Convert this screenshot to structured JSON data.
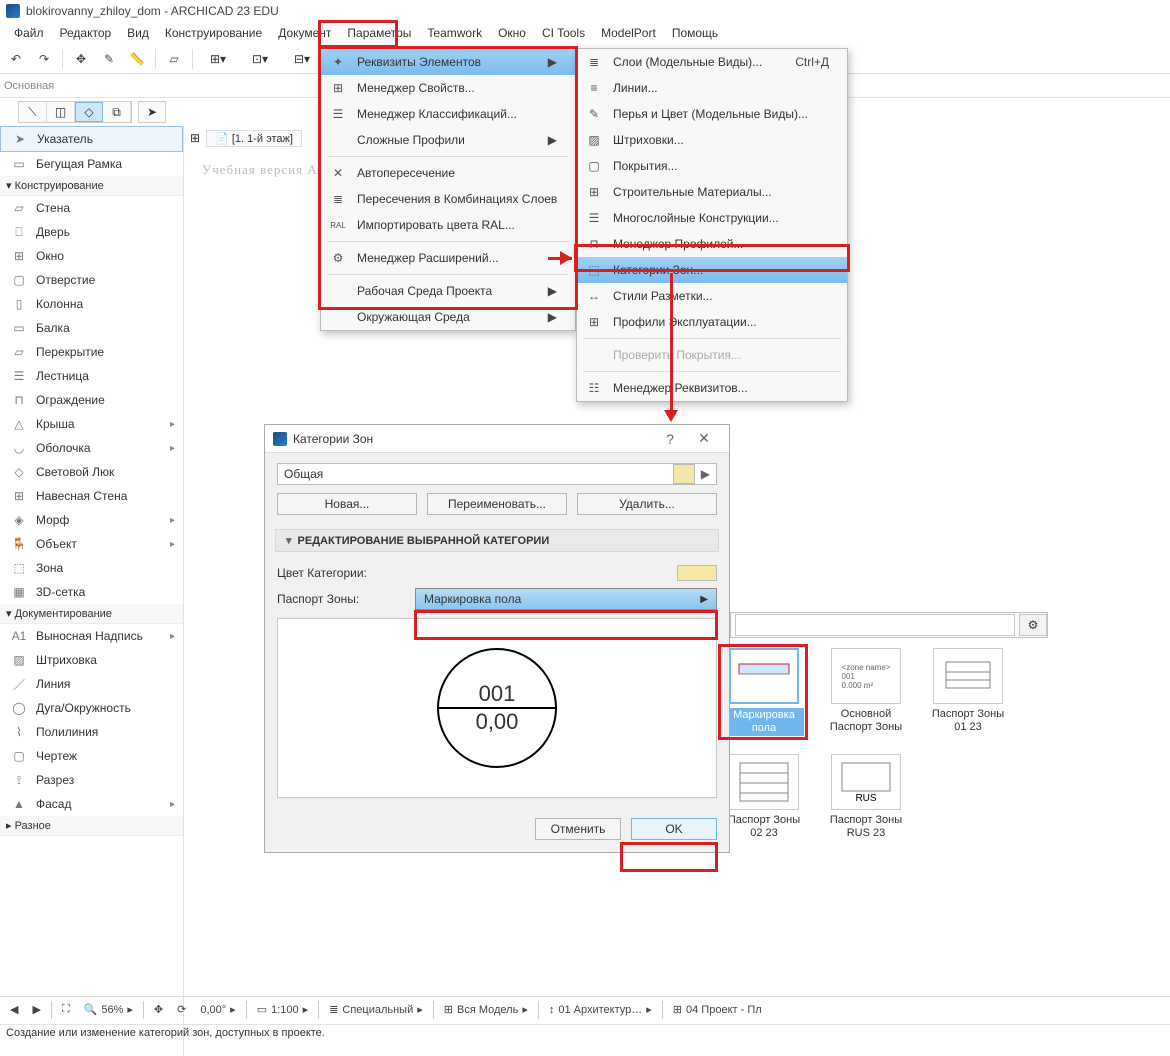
{
  "window": {
    "title": "blokirovanny_zhiloy_dom - ARCHICAD 23 EDU"
  },
  "menubar": [
    "Файл",
    "Редактор",
    "Вид",
    "Конструирование",
    "Документ",
    "Параметры",
    "Teamwork",
    "Окно",
    "CI Tools",
    "ModelPort",
    "Помощь"
  ],
  "sub_toolbar_label": "Основная",
  "menu_params": {
    "items": [
      {
        "label": "Реквизиты Элементов",
        "arrow": true,
        "hl": true
      },
      {
        "label": "Менеджер Свойств...",
        "icon": "grid"
      },
      {
        "label": "Менеджер Классификаций...",
        "icon": "stack"
      },
      {
        "label": "Сложные Профили",
        "arrow": true
      },
      {
        "label": "Автопересечение",
        "icon": "cross",
        "sep_before": true
      },
      {
        "label": "Пересечения в Комбинациях Слоев",
        "icon": "layers"
      },
      {
        "label": "Импортировать цвета RAL...",
        "icon": "RAL"
      },
      {
        "label": "Менеджер Расширений...",
        "icon": "plug",
        "sep_before": true
      },
      {
        "label": "Рабочая Среда Проекта",
        "arrow": true,
        "sep_before": true
      },
      {
        "label": "Окружающая Среда",
        "arrow": true
      }
    ]
  },
  "menu_rekv": {
    "items": [
      {
        "label": "Слои (Модельные Виды)...",
        "shortcut": "Ctrl+Д",
        "icon": "layers"
      },
      {
        "label": "Линии...",
        "icon": "lines"
      },
      {
        "label": "Перья и Цвет (Модельные Виды)...",
        "icon": "pen"
      },
      {
        "label": "Штриховки...",
        "icon": "hatch"
      },
      {
        "label": "Покрытия...",
        "icon": "surf"
      },
      {
        "label": "Строительные Материалы...",
        "icon": "mat"
      },
      {
        "label": "Многослойные Конструкции...",
        "icon": "multi"
      },
      {
        "label": "Менеджер Профилей...",
        "icon": "prof"
      },
      {
        "label": "Категории Зон...",
        "icon": "zone",
        "hl": true
      },
      {
        "label": "Стили Разметки...",
        "icon": "dim"
      },
      {
        "label": "Профили Эксплуатации...",
        "icon": "exp"
      },
      {
        "label": "Проверить Покрытия...",
        "disabled": true,
        "sep_before": true
      },
      {
        "label": "Менеджер Реквизитов...",
        "icon": "mgr",
        "sep_before": true
      }
    ]
  },
  "sidebar": {
    "sections": [
      {
        "title": "",
        "items": [
          {
            "label": "Указатель",
            "sel": true
          },
          {
            "label": "Бегущая Рамка"
          }
        ]
      },
      {
        "title": "Конструирование",
        "collapsible": true,
        "items": [
          {
            "label": "Стена"
          },
          {
            "label": "Дверь"
          },
          {
            "label": "Окно"
          },
          {
            "label": "Отверстие"
          },
          {
            "label": "Колонна"
          },
          {
            "label": "Балка"
          },
          {
            "label": "Перекрытие"
          },
          {
            "label": "Лестница"
          },
          {
            "label": "Ограждение"
          },
          {
            "label": "Крыша",
            "arrow": true
          },
          {
            "label": "Оболочка",
            "arrow": true
          },
          {
            "label": "Световой Люк"
          },
          {
            "label": "Навесная Стена"
          },
          {
            "label": "Морф",
            "arrow": true
          },
          {
            "label": "Объект",
            "arrow": true
          },
          {
            "label": "Зона"
          },
          {
            "label": "3D-сетка"
          }
        ]
      },
      {
        "title": "Документирование",
        "collapsible": true,
        "items": [
          {
            "label": "Выносная Надпись",
            "arrow": true,
            "prefix": "A1"
          },
          {
            "label": "Штриховка"
          },
          {
            "label": "Линия"
          },
          {
            "label": "Дуга/Окружность"
          },
          {
            "label": "Полилиния"
          },
          {
            "label": "Чертеж"
          },
          {
            "label": "Разрез"
          },
          {
            "label": "Фасад",
            "arrow": true
          }
        ]
      },
      {
        "title": "Разное",
        "collapsible": true,
        "items": []
      }
    ]
  },
  "tab": {
    "name": "[1. 1-й этаж]"
  },
  "watermark": "Учебная версия ARCHI",
  "dialog": {
    "title": "Категории Зон",
    "category_selected": "Общая",
    "btn_new": "Новая...",
    "btn_rename": "Переименовать...",
    "btn_delete": "Удалить...",
    "section": "РЕДАКТИРОВАНИЕ ВЫБРАННОЙ КАТЕГОРИИ",
    "lbl_color": "Цвет Категории:",
    "lbl_passport": "Паспорт Зоны:",
    "passport_value": "Маркировка пола",
    "preview_top": "001",
    "preview_bottom": "0,00",
    "btn_cancel": "Отменить",
    "btn_ok": "OK"
  },
  "gallery": {
    "items": [
      {
        "label": "Маркировка пола",
        "sel": true
      },
      {
        "label": "Основной Паспорт Зоны"
      },
      {
        "label": "Паспорт Зоны 01 23"
      },
      {
        "label": "Паспорт Зоны 02 23"
      },
      {
        "label": "Паспорт Зоны RUS 23"
      }
    ]
  },
  "statusbar": {
    "zoom": "56%",
    "angle": "0,00°",
    "scale": "1:100",
    "layer_set": "Специальный",
    "model": "Вся Модель",
    "view": "01 Архитектур…",
    "layout": "04 Проект - Пл"
  },
  "hint": "Создание или изменение категорий зон, доступных в проекте."
}
